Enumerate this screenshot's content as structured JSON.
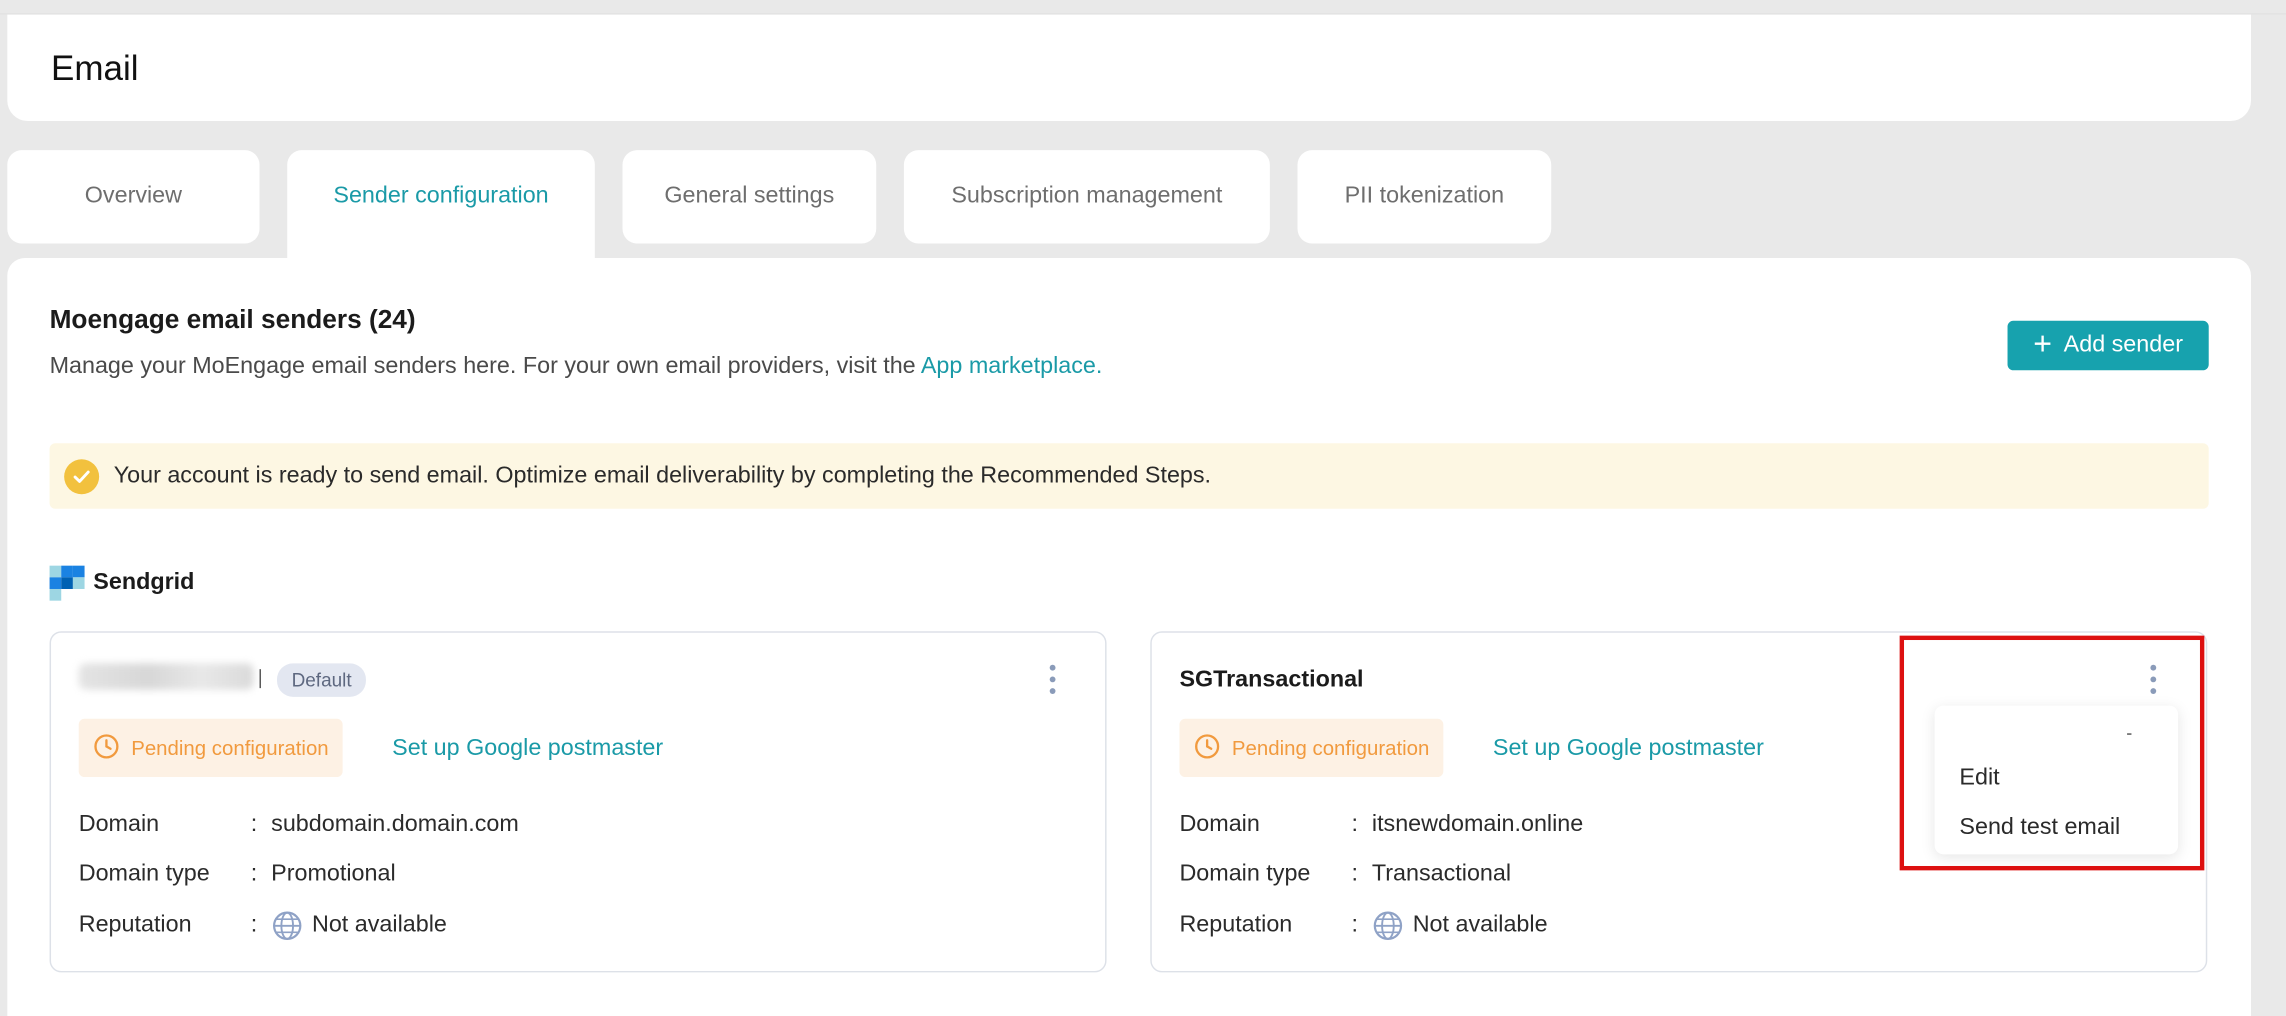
{
  "page": {
    "title": "Email"
  },
  "tabs": [
    {
      "label": "Overview",
      "active": false
    },
    {
      "label": "Sender configuration",
      "active": true
    },
    {
      "label": "General settings",
      "active": false
    },
    {
      "label": "Subscription management",
      "active": false
    },
    {
      "label": "PII tokenization",
      "active": false
    }
  ],
  "section": {
    "title": "Moengage email senders (24)",
    "description": "Manage your MoEngage email senders here. For your own email providers, visit the ",
    "link": "App marketplace.",
    "add_button": "Add sender",
    "add_icon": "plus-icon"
  },
  "banner": {
    "icon": "check-circle-icon",
    "text": "Your account is ready to send email. Optimize email deliverability by completing the Recommended Steps."
  },
  "provider": {
    "name": "Sendgrid",
    "logo": "sendgrid-logo"
  },
  "cards": [
    {
      "name": "",
      "name_blurred": true,
      "badge": "Default",
      "status": "Pending configuration",
      "status_icon": "clock-icon",
      "postmaster_link": "Set up Google postmaster",
      "rows": [
        {
          "key": "Domain",
          "value": "subdomain.domain.com"
        },
        {
          "key": "Domain type",
          "value": "Promotional"
        },
        {
          "key": "Reputation",
          "value": "Not available",
          "icon": "globe-icon"
        }
      ]
    },
    {
      "name": "SGTransactional",
      "badge": "",
      "status": "Pending configuration",
      "status_icon": "clock-icon",
      "postmaster_link": "Set up Google postmaster",
      "rows": [
        {
          "key": "Domain",
          "value": "itsnewdomain.online"
        },
        {
          "key": "Domain type",
          "value": "Transactional"
        },
        {
          "key": "Reputation",
          "value": "Not available",
          "icon": "globe-icon"
        }
      ]
    }
  ],
  "menu": {
    "items": [
      "Edit",
      "Send test email"
    ]
  },
  "colors": {
    "accent": "#17a2ae",
    "link": "#1a9aa7",
    "pending_text": "#f19a3e",
    "pending_bg": "#fdf1e4",
    "banner_bg": "#fdf7e3",
    "highlight": "#dd1010"
  }
}
